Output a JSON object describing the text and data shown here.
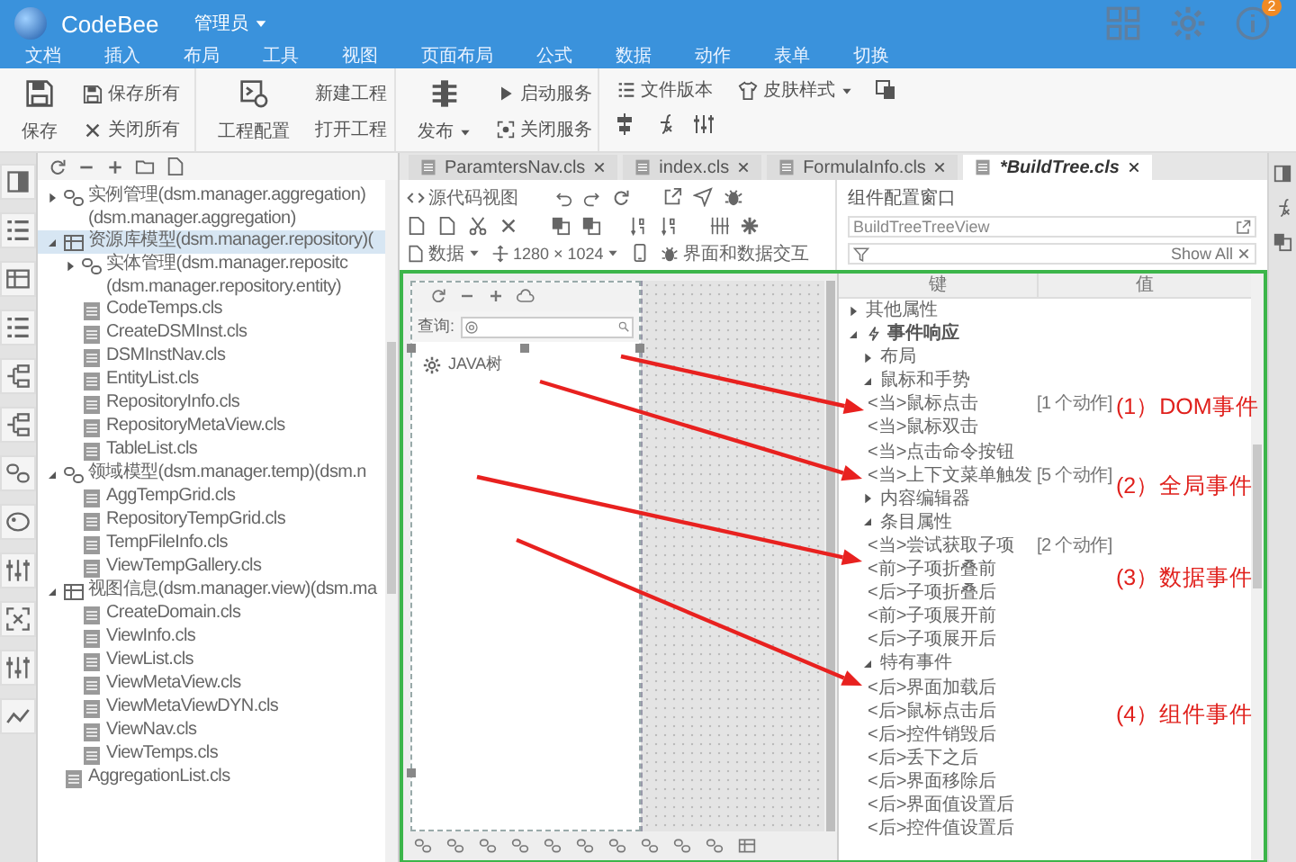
{
  "app": {
    "name": "CodeBee",
    "user": "管理员",
    "badge": "2"
  },
  "menu": [
    "文档",
    "插入",
    "布局",
    "工具",
    "视图",
    "页面布局",
    "公式",
    "数据",
    "动作",
    "表单",
    "切换"
  ],
  "ribbon": {
    "save": "保存",
    "save_all": "保存所有",
    "close_all": "关闭所有",
    "project_config": "工程配置",
    "new_project": "新建工程",
    "open_project": "打开工程",
    "publish": "发布",
    "start_service": "启动服务",
    "stop_service": "关闭服务",
    "file_version": "文件版本",
    "skin_style": "皮肤样式"
  },
  "project_tree": [
    {
      "label": "实例管理(dsm.manager.aggregation)",
      "sublabel": "(dsm.manager.aggregation)",
      "kind": "folder",
      "expanded": false,
      "selected": false
    },
    {
      "label": "资源库模型(dsm.manager.repository)(",
      "kind": "folder",
      "expanded": true,
      "selected": true,
      "children": [
        {
          "label": "实体管理(dsm.manager.repositc",
          "sublabel": "(dsm.manager.repository.entity)",
          "kind": "folder",
          "expanded": false,
          "selected": false
        },
        {
          "label": "CodeTemps.cls",
          "kind": "file",
          "selected": false
        },
        {
          "label": "CreateDSMInst.cls",
          "kind": "file",
          "selected": false
        },
        {
          "label": "DSMInstNav.cls",
          "kind": "file",
          "selected": false
        },
        {
          "label": "EntityList.cls",
          "kind": "file",
          "selected": false
        },
        {
          "label": "RepositoryInfo.cls",
          "kind": "file",
          "selected": false
        },
        {
          "label": "RepositoryMetaView.cls",
          "kind": "file",
          "selected": false
        },
        {
          "label": "TableList.cls",
          "kind": "file",
          "selected": false
        }
      ]
    },
    {
      "label": "领域模型(dsm.manager.temp)(dsm.n",
      "kind": "folder",
      "expanded": true,
      "selected": false,
      "children": [
        {
          "label": "AggTempGrid.cls",
          "kind": "file",
          "selected": false
        },
        {
          "label": "RepositoryTempGrid.cls",
          "kind": "file",
          "selected": false
        },
        {
          "label": "TempFileInfo.cls",
          "kind": "file",
          "selected": false
        },
        {
          "label": "ViewTempGallery.cls",
          "kind": "file",
          "selected": false
        }
      ]
    },
    {
      "label": "视图信息(dsm.manager.view)(dsm.ma",
      "kind": "folder",
      "expanded": true,
      "selected": false,
      "children": [
        {
          "label": "CreateDomain.cls",
          "kind": "file",
          "selected": false
        },
        {
          "label": "ViewInfo.cls",
          "kind": "file",
          "selected": false
        },
        {
          "label": "ViewList.cls",
          "kind": "file",
          "selected": false
        },
        {
          "label": "ViewMetaView.cls",
          "kind": "file",
          "selected": false
        },
        {
          "label": "ViewMetaViewDYN.cls",
          "kind": "file",
          "selected": false
        },
        {
          "label": "ViewNav.cls",
          "kind": "file",
          "selected": false
        },
        {
          "label": "ViewTemps.cls",
          "kind": "file",
          "selected": false
        }
      ]
    },
    {
      "label": "AggregationList.cls",
      "kind": "file",
      "selected": false
    }
  ],
  "editor_tabs": [
    {
      "label": "ParamtersNav.cls",
      "selected": false
    },
    {
      "label": "index.cls",
      "selected": false
    },
    {
      "label": "FormulaInfo.cls",
      "selected": false
    },
    {
      "label": "*BuildTree.cls",
      "selected": true
    }
  ],
  "editor_toolbar": {
    "source_view": "源代码视图",
    "data": "数据",
    "resolution": "1280 × 1024",
    "interaction": "界面和数据交互"
  },
  "canvas": {
    "query_label": "查询:",
    "tree_node": "JAVA树"
  },
  "config_panel": {
    "title": "组件配置窗口",
    "component": "BuildTreeTreeView",
    "filter_action": "Show All",
    "columns": [
      "键",
      "值"
    ],
    "rows": [
      {
        "key": "其他属性",
        "kind": "group",
        "expanded": false
      },
      {
        "key": "事件响应",
        "kind": "section",
        "expanded": true,
        "children": [
          {
            "key": "布局",
            "kind": "group",
            "expanded": false
          },
          {
            "key": "鼠标和手势",
            "kind": "group",
            "expanded": true,
            "children": [
              {
                "key": "<当>鼠标点击",
                "kind": "event",
                "value": "[1 个动作]"
              },
              {
                "key": "<当>鼠标双击",
                "kind": "event"
              },
              {
                "key": "<当>点击命令按钮",
                "kind": "event"
              },
              {
                "key": "<当>上下文菜单触发",
                "kind": "event",
                "value": "[5 个动作]"
              }
            ]
          },
          {
            "key": "内容编辑器",
            "kind": "group",
            "expanded": false
          },
          {
            "key": "条目属性",
            "kind": "group",
            "expanded": true,
            "children": [
              {
                "key": "<当>尝试获取子项",
                "kind": "event",
                "value": "[2 个动作]"
              },
              {
                "key": "<前>子项折叠前",
                "kind": "event"
              },
              {
                "key": "<后>子项折叠后",
                "kind": "event"
              },
              {
                "key": "<前>子项展开前",
                "kind": "event"
              },
              {
                "key": "<后>子项展开后",
                "kind": "event"
              }
            ]
          },
          {
            "key": "特有事件",
            "kind": "group",
            "expanded": true,
            "children": [
              {
                "key": "<后>界面加载后",
                "kind": "event"
              },
              {
                "key": "<后>鼠标点击后",
                "kind": "event"
              },
              {
                "key": "<后>控件销毁后",
                "kind": "event"
              },
              {
                "key": "<后>丢下之后",
                "kind": "event"
              },
              {
                "key": "<后>界面移除后",
                "kind": "event"
              },
              {
                "key": "<后>界面值设置后",
                "kind": "event"
              },
              {
                "key": "<后>控件值设置后",
                "kind": "event"
              }
            ]
          }
        ]
      }
    ]
  },
  "annotations": [
    {
      "label": "(1）DOM事件"
    },
    {
      "label": "(2）全局事件"
    },
    {
      "label": "(3）数据事件"
    },
    {
      "label": "(4）组件事件"
    }
  ]
}
